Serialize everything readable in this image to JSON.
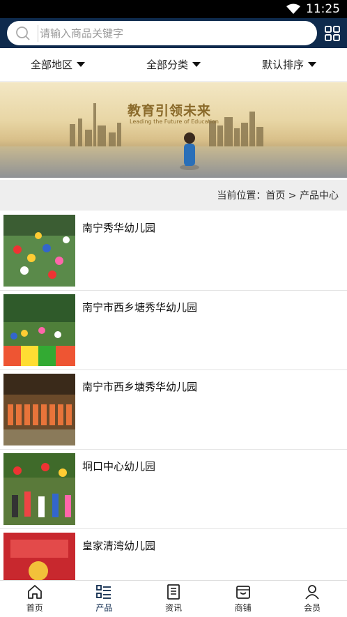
{
  "status_bar": {
    "time": "11:25",
    "icons": [
      "wifi-icon"
    ]
  },
  "search": {
    "placeholder": "请输入商品关键字",
    "icon": "search-icon"
  },
  "header": {
    "menu_icon": "grid-icon"
  },
  "filters": [
    {
      "label": "全部地区"
    },
    {
      "label": "全部分类"
    },
    {
      "label": "默认排序"
    }
  ],
  "banner": {
    "title": "教育引领未来",
    "subtitle": "Leading the Future of Education"
  },
  "breadcrumb": {
    "text": "当前位置：首页 > 产品中心"
  },
  "products": [
    {
      "name": "南宁秀华幼儿园"
    },
    {
      "name": "南宁市西乡塘秀华幼儿园"
    },
    {
      "name": "南宁市西乡塘秀华幼儿园"
    },
    {
      "name": "坰口中心幼儿园"
    },
    {
      "name": "皇家清湾幼儿园"
    }
  ],
  "bottom_nav": [
    {
      "label": "首页",
      "icon": "home-icon"
    },
    {
      "label": "产品",
      "icon": "list-icon"
    },
    {
      "label": "资讯",
      "icon": "news-icon"
    },
    {
      "label": "商铺",
      "icon": "store-icon"
    },
    {
      "label": "会员",
      "icon": "user-icon"
    }
  ],
  "colors": {
    "header_bg": "#0e2a4d",
    "status_bg": "#000000",
    "active_nav": "#0e2a4d"
  }
}
